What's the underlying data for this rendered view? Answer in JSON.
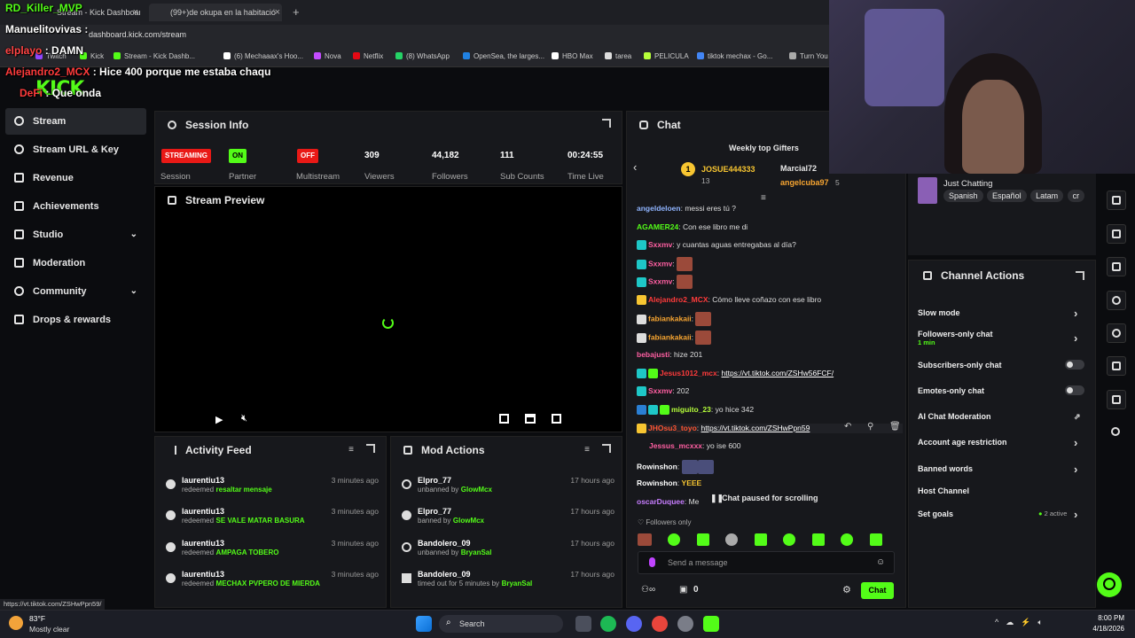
{
  "browser": {
    "tabs": [
      {
        "label": "Stream - Kick Dashboard"
      },
      {
        "label": "(99+)de okupa en la habitació"
      }
    ],
    "url": "dashboard.kick.com/stream",
    "bookmarks": [
      "Twitch",
      "Kick",
      "Stream - Kick Dashb...",
      "(6) Mechaaax's Hoo...",
      "Nova",
      "Netflix",
      "(8) WhatsApp",
      "OpenSea, the larges...",
      "HBO Max",
      "tarea",
      "PELICULA",
      "tiktok mechax - Go...",
      "Turn You"
    ],
    "status_url": "https://vt.tiktok.com/ZSHwPpn59/"
  },
  "overlay": {
    "lines": [
      {
        "user": "RD_Killer_MVP",
        "sep": " : ",
        "text": ""
      },
      {
        "user": "Manuelitovivas",
        "sep": " : ",
        "text": ""
      },
      {
        "user": "elplayo",
        "sep": " : ",
        "text": "DAMN"
      },
      {
        "user": "Alejandro2_MCX",
        "sep": " : ",
        "text": "Hice 400 porque me estaba chaqu"
      },
      {
        "user": "DeFi",
        "sep": " : ",
        "text": "Que onda"
      }
    ],
    "logo": "KICK"
  },
  "sidebar": {
    "items": [
      {
        "label": "Stream",
        "icon": "broadcast-icon"
      },
      {
        "label": "Stream URL & Key",
        "icon": "link-icon"
      },
      {
        "label": "Revenue",
        "icon": "chart-icon"
      },
      {
        "label": "Achievements",
        "icon": "trophy-icon"
      },
      {
        "label": "Studio",
        "icon": "studio-icon"
      },
      {
        "label": "Moderation",
        "icon": "wrench-icon"
      },
      {
        "label": "Community",
        "icon": "people-icon"
      },
      {
        "label": "Drops & rewards",
        "icon": "gift-icon"
      }
    ]
  },
  "session": {
    "title": "Session Info",
    "streaming_badge": "STREAMING",
    "partner_badge": "ON",
    "multistream_badge": "OFF",
    "labels": [
      "Session",
      "Partner",
      "Multistream",
      "Viewers",
      "Followers",
      "Sub Counts",
      "Time Live"
    ],
    "viewers": "309",
    "followers": "44,182",
    "subs": "111",
    "time_live": "00:24:55"
  },
  "preview": {
    "title": "Stream Preview"
  },
  "activity": {
    "title": "Activity Feed",
    "items": [
      {
        "user": "laurentiu13",
        "verb": "redeemed",
        "reward": "resaltar mensaje",
        "time": "3 minutes ago"
      },
      {
        "user": "laurentiu13",
        "verb": "redeemed",
        "reward": "SE VALE MATAR BASURA",
        "time": "3 minutes ago"
      },
      {
        "user": "laurentiu13",
        "verb": "redeemed",
        "reward": "AMPAGA TOBERO",
        "time": "3 minutes ago"
      },
      {
        "user": "laurentiu13",
        "verb": "redeemed",
        "reward": "MECHAX PVPERO DE MIERDA",
        "time": "3 minutes ago"
      }
    ]
  },
  "mod": {
    "title": "Mod Actions",
    "items": [
      {
        "user": "Elpro_77",
        "action": "unbanned by",
        "by": "GlowMcx",
        "time": "17 hours ago"
      },
      {
        "user": "Elpro_77",
        "action": "banned by",
        "by": "GlowMcx",
        "time": "17 hours ago"
      },
      {
        "user": "Bandolero_09",
        "action": "unbanned by",
        "by": "BryanSal",
        "time": "17 hours ago"
      },
      {
        "user": "Bandolero_09",
        "action": "timed out for 5 minutes by",
        "by": "BryanSal",
        "time": "17 hours ago"
      }
    ]
  },
  "chat": {
    "title": "Chat",
    "gifters_title": "Weekly top Gifters",
    "gifters": [
      {
        "rank": "1",
        "name": "JOSUE444333",
        "count": "13"
      },
      {
        "rank": "",
        "name": "Marcial72",
        "count": ""
      },
      {
        "rank": "",
        "name": "angelcuba97",
        "count": "5"
      }
    ],
    "messages": [
      {
        "user": "angeldeloen",
        "color": "#8fb4ff",
        "text": "messi eres tú ?"
      },
      {
        "user": "AGAMER24",
        "color": "#53fc18",
        "text": "Con ese libro me di"
      },
      {
        "user": "Sxxmv",
        "color": "#ff5fa2",
        "text": "y cuantas aguas entregabas al día?"
      },
      {
        "user": "Sxxmv",
        "color": "#ff5fa2",
        "text": ""
      },
      {
        "user": "Sxxmv",
        "color": "#ff5fa2",
        "text": ""
      },
      {
        "user": "Alejandro2_MCX",
        "color": "#ff3b3b",
        "text": "Cómo lleve coñazo con ese libro"
      },
      {
        "user": "fabiankakaii",
        "color": "#f7a531",
        "text": ""
      },
      {
        "user": "fabiankakaii",
        "color": "#f7a531",
        "text": ""
      },
      {
        "user": "bebajusti",
        "color": "#ff5fa2",
        "text": "hize 201"
      },
      {
        "user": "Jesus1012_mcx",
        "color": "#ff3b3b",
        "text": "https://vt.tiktok.com/ZSHw56FCF/"
      },
      {
        "user": "Sxxmv",
        "color": "#ff5fa2",
        "text": "202"
      },
      {
        "user": "miguito_23",
        "color": "#b6ff3a",
        "text": "yo hice 342"
      },
      {
        "user": "JHOsu3_toyo",
        "color": "#ff5533",
        "text": "https://vt.tiktok.com/ZSHwPpn59"
      },
      {
        "user": "Jessus_mcxxx",
        "color": "#ff5fa2",
        "text": "yo ise 600"
      },
      {
        "user": "Rowinshon",
        "color": "#ffffff",
        "text": ""
      },
      {
        "user": "Rowinshon",
        "color": "#ffffff",
        "text": "YEEE"
      },
      {
        "user": "oscarDuquee",
        "color": "#c77dff",
        "text": "Me"
      }
    ],
    "paused": "Chat paused for scrolling",
    "followers_only": "Followers only",
    "input_placeholder": "Send a message",
    "count": "0",
    "send_label": "Chat"
  },
  "stream_info": {
    "category": "Just Chatting",
    "tags": [
      "Spanish",
      "Español",
      "Latam",
      "cr"
    ]
  },
  "channel_actions": {
    "title": "Channel Actions",
    "items": [
      {
        "label": "Slow mode",
        "sub": "",
        "ctrl": "arrow"
      },
      {
        "label": "Followers-only chat",
        "sub": "1 min",
        "ctrl": "arrow"
      },
      {
        "label": "Subscribers-only chat",
        "sub": "",
        "ctrl": "toggle"
      },
      {
        "label": "Emotes-only chat",
        "sub": "",
        "ctrl": "toggle"
      },
      {
        "label": "AI Chat Moderation",
        "sub": "",
        "ctrl": "external"
      },
      {
        "label": "Account age restriction",
        "sub": "",
        "ctrl": "arrow"
      },
      {
        "label": "Banned words",
        "sub": "",
        "ctrl": "arrow"
      },
      {
        "label": "Host Channel",
        "sub": "",
        "ctrl": "none"
      },
      {
        "label": "Set goals",
        "sub": "2 active",
        "ctrl": "arrow"
      }
    ]
  },
  "taskbar": {
    "weather_temp": "83°F",
    "weather_desc": "Mostly clear",
    "search_label": "Search",
    "time": "8:00 PM",
    "date": "4/18/2026"
  },
  "colors": {
    "kick_green": "#53fc18",
    "panel": "#17181c",
    "streaming": "#e91916"
  }
}
